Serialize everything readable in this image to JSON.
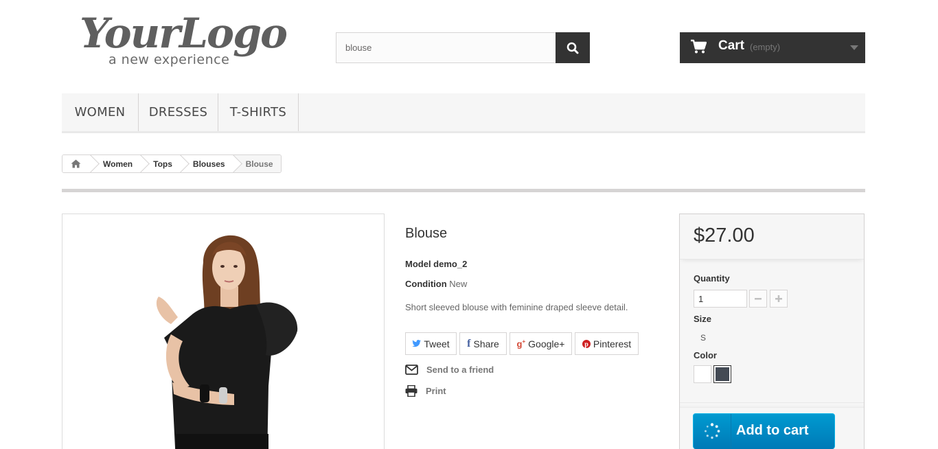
{
  "header": {
    "logo_script": "YourLogo",
    "logo_tagline": "a new experience",
    "search_value": "blouse",
    "cart_label": "Cart",
    "cart_status": "(empty)"
  },
  "menu": {
    "items": [
      {
        "label": "WOMEN"
      },
      {
        "label": "DRESSES"
      },
      {
        "label": "T-SHIRTS"
      }
    ]
  },
  "breadcrumb": {
    "items": [
      {
        "label": "Women"
      },
      {
        "label": "Tops"
      },
      {
        "label": "Blouses"
      }
    ],
    "current": "Blouse"
  },
  "product": {
    "title": "Blouse",
    "model": "Model demo_2",
    "condition_label": "Condition",
    "condition_value": "New",
    "description": "Short sleeved blouse with feminine draped sleeve detail.",
    "share_buttons": [
      {
        "label": "Tweet",
        "icon": "twitter-icon"
      },
      {
        "label": "Share",
        "icon": "facebook-icon"
      },
      {
        "label": "Google+",
        "icon": "google-plus-icon"
      },
      {
        "label": "Pinterest",
        "icon": "pinterest-icon"
      }
    ],
    "send_to_friend": "Send to a friend",
    "print": "Print"
  },
  "buy_box": {
    "price": "$27.00",
    "quantity_label": "Quantity",
    "quantity_value": "1",
    "size_label": "Size",
    "size_value": "S",
    "color_label": "Color",
    "colors": [
      "#ffffff",
      "#434a54"
    ],
    "add_to_cart": "Add to cart"
  },
  "colors": {
    "dark": "#333333",
    "accent_blue": "#0e8fcf",
    "panel": "#f6f6f6"
  }
}
